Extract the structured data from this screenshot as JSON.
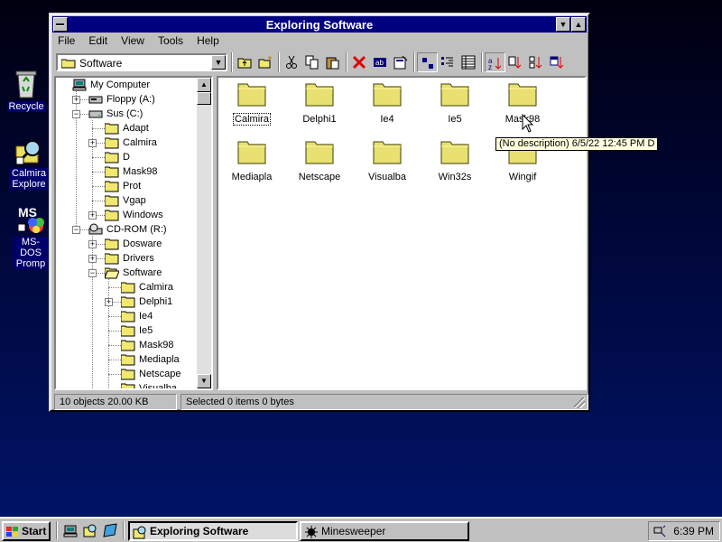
{
  "desktop": {
    "icons": [
      {
        "label": "Recycle",
        "icon": "recycle-bin-icon"
      },
      {
        "label": "Calmira Explore",
        "icon": "calmira-explorer-icon"
      },
      {
        "label": "MS-DOS Promp",
        "icon": "ms-dos-icon"
      }
    ]
  },
  "window": {
    "title": "Exploring Software",
    "menu": [
      "File",
      "Edit",
      "View",
      "Tools",
      "Help"
    ],
    "address": "Software",
    "toolbar_icons": [
      "up-folder-icon",
      "new-folder-icon",
      "cut-icon",
      "copy-icon",
      "paste-icon",
      "delete-icon",
      "rename-icon",
      "properties-icon",
      "large-icons-icon",
      "list-view-icon",
      "details-view-icon",
      "sort-name-icon",
      "sort-type-icon",
      "sort-size-icon",
      "sort-date-icon"
    ]
  },
  "tree": {
    "nodes": [
      {
        "label": "My Computer",
        "level": 0,
        "icon": "computer-icon",
        "toggle": ""
      },
      {
        "label": "Floppy (A:)",
        "level": 1,
        "icon": "floppy-icon",
        "toggle": "+"
      },
      {
        "label": "Sus (C:)",
        "level": 1,
        "icon": "harddisk-icon",
        "toggle": "-"
      },
      {
        "label": "Adapt",
        "level": 2,
        "icon": "folder-icon",
        "toggle": ""
      },
      {
        "label": "Calmira",
        "level": 2,
        "icon": "folder-icon",
        "toggle": "+"
      },
      {
        "label": "D",
        "level": 2,
        "icon": "folder-icon",
        "toggle": ""
      },
      {
        "label": "Mask98",
        "level": 2,
        "icon": "folder-icon",
        "toggle": ""
      },
      {
        "label": "Prot",
        "level": 2,
        "icon": "folder-icon",
        "toggle": ""
      },
      {
        "label": "Vgap",
        "level": 2,
        "icon": "folder-icon",
        "toggle": ""
      },
      {
        "label": "Windows",
        "level": 2,
        "icon": "folder-icon",
        "toggle": "+"
      },
      {
        "label": "CD-ROM (R:)",
        "level": 1,
        "icon": "cdrom-icon",
        "toggle": "-"
      },
      {
        "label": "Dosware",
        "level": 2,
        "icon": "folder-icon",
        "toggle": "+"
      },
      {
        "label": "Drivers",
        "level": 2,
        "icon": "folder-icon",
        "toggle": "+"
      },
      {
        "label": "Software",
        "level": 2,
        "icon": "open-folder-icon",
        "toggle": "-"
      },
      {
        "label": "Calmira",
        "level": 3,
        "icon": "folder-icon",
        "toggle": ""
      },
      {
        "label": "Delphi1",
        "level": 3,
        "icon": "folder-icon",
        "toggle": "+"
      },
      {
        "label": "Ie4",
        "level": 3,
        "icon": "folder-icon",
        "toggle": ""
      },
      {
        "label": "Ie5",
        "level": 3,
        "icon": "folder-icon",
        "toggle": ""
      },
      {
        "label": "Mask98",
        "level": 3,
        "icon": "folder-icon",
        "toggle": ""
      },
      {
        "label": "Mediapla",
        "level": 3,
        "icon": "folder-icon",
        "toggle": ""
      },
      {
        "label": "Netscape",
        "level": 3,
        "icon": "folder-icon",
        "toggle": ""
      },
      {
        "label": "Visualba",
        "level": 3,
        "icon": "folder-icon",
        "toggle": ""
      }
    ]
  },
  "files": [
    {
      "name": "Calmira",
      "focused": true
    },
    {
      "name": "Delphi1"
    },
    {
      "name": "Ie4"
    },
    {
      "name": "Ie5"
    },
    {
      "name": "Mask98"
    },
    {
      "name": "Mediapla"
    },
    {
      "name": "Netscape"
    },
    {
      "name": "Visualba"
    },
    {
      "name": "Win32s"
    },
    {
      "name": "Wingif"
    }
  ],
  "tooltip": "(No description)  6/5/22  12:45 PM  D",
  "status": {
    "objects": "10 objects  20.00 KB",
    "selected": "Selected 0 items  0 bytes"
  },
  "taskbar": {
    "start_label": "Start",
    "tasks": [
      {
        "label": "Exploring Software",
        "active": true,
        "icon": "explorer-icon"
      },
      {
        "label": "Minesweeper",
        "active": false,
        "icon": "mine-icon"
      }
    ],
    "clock": "6:39 PM"
  }
}
